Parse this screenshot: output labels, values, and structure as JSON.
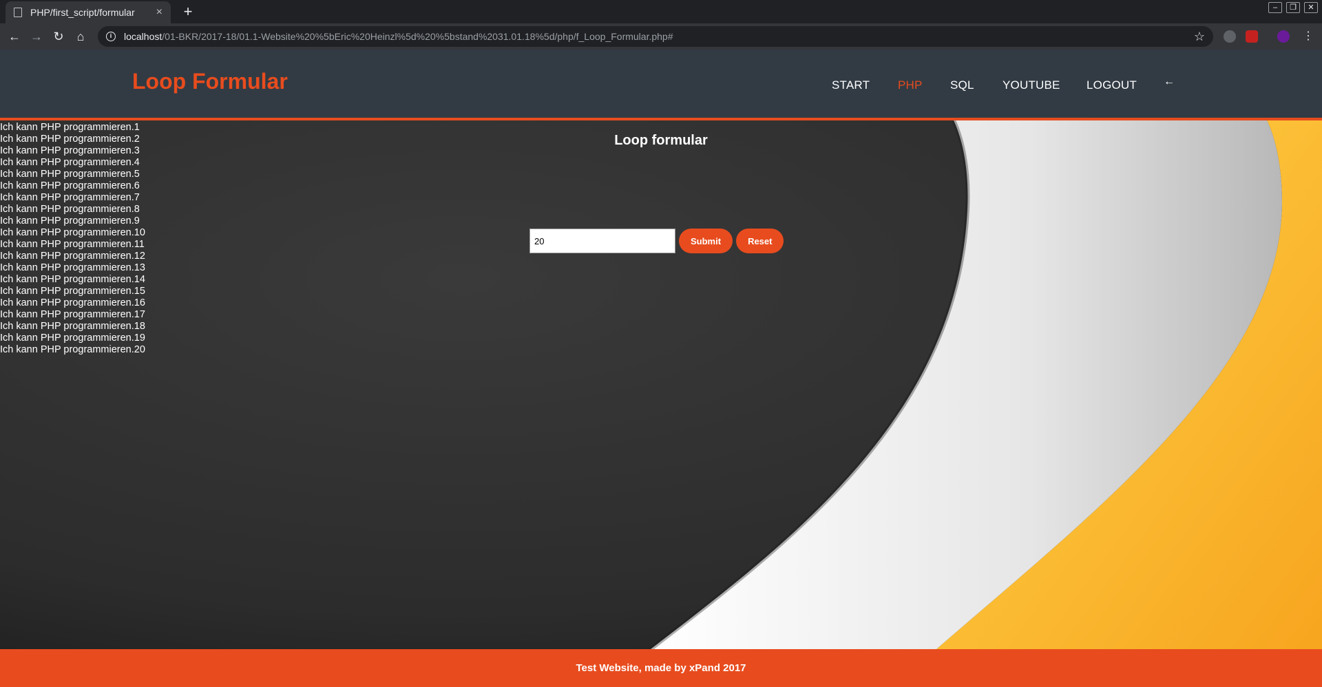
{
  "browser": {
    "tab_title": "PHP/first_script/formular",
    "tab_close": "×",
    "new_tab": "+",
    "url_host": "localhost",
    "url_path": "/01-BKR/2017-18/01.1-Website%20%5bEric%20Heinzl%5d%20%5bstand%2031.01.18%5d/php/f_Loop_Formular.php#",
    "back": "←",
    "forward": "→",
    "reload": "↻",
    "home": "⌂",
    "star": "☆",
    "info": "i",
    "minimize": "–",
    "restore": "❐",
    "close": "✕"
  },
  "header": {
    "logo": "Loop Formular",
    "nav": [
      "START",
      "PHP",
      "SQL",
      "YOUTUBE",
      "LOGOUT"
    ],
    "active_nav": "PHP",
    "back_arrow": "←"
  },
  "main": {
    "heading": "Loop formular",
    "lines": [
      "Ich kann PHP programmieren.1",
      "Ich kann PHP programmieren.2",
      "Ich kann PHP programmieren.3",
      "Ich kann PHP programmieren.4",
      "Ich kann PHP programmieren.5",
      "Ich kann PHP programmieren.6",
      "Ich kann PHP programmieren.7",
      "Ich kann PHP programmieren.8",
      "Ich kann PHP programmieren.9",
      "Ich kann PHP programmieren.10",
      "Ich kann PHP programmieren.11",
      "Ich kann PHP programmieren.12",
      "Ich kann PHP programmieren.13",
      "Ich kann PHP programmieren.14",
      "Ich kann PHP programmieren.15",
      "Ich kann PHP programmieren.16",
      "Ich kann PHP programmieren.17",
      "Ich kann PHP programmieren.18",
      "Ich kann PHP programmieren.19",
      "Ich kann PHP programmieren.20"
    ],
    "input_value": "20",
    "submit_label": "Submit",
    "reset_label": "Reset"
  },
  "footer": {
    "text": "Test Website, made by xPand 2017"
  },
  "colors": {
    "accent": "#e84c1e",
    "header_bg": "#323b44",
    "main_bg": "#2f2f2f",
    "swoosh_white": "#eeeeee",
    "swoosh_yellow": "#fdc02f"
  }
}
